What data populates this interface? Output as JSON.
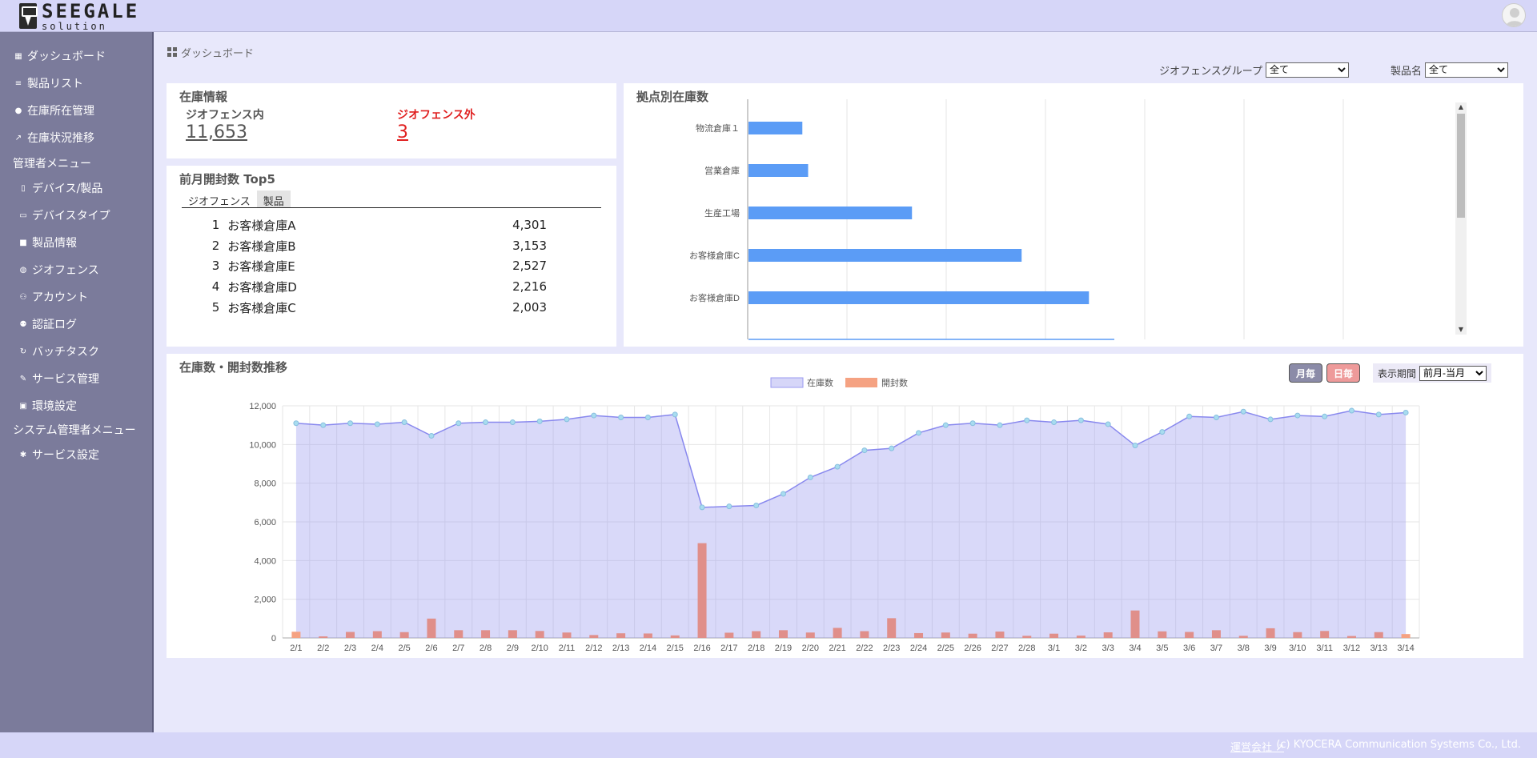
{
  "header": {
    "logo_main": "SEEGALE",
    "logo_sub": "solution"
  },
  "sidebar": {
    "items": [
      {
        "label": "ダッシュボード",
        "icon": "dashboard-icon"
      },
      {
        "label": "製品リスト",
        "icon": "list-icon"
      },
      {
        "label": "在庫所在管理",
        "icon": "map-pin-icon"
      },
      {
        "label": "在庫状況推移",
        "icon": "trend-icon"
      }
    ],
    "admin_heading": "管理者メニュー",
    "admin_items": [
      {
        "label": "デバイス/製品",
        "icon": "device-icon"
      },
      {
        "label": "デバイスタイプ",
        "icon": "device-type-icon"
      },
      {
        "label": "製品情報",
        "icon": "tag-icon"
      },
      {
        "label": "ジオフェンス",
        "icon": "globe-icon"
      },
      {
        "label": "アカウント",
        "icon": "users-icon"
      },
      {
        "label": "認証ログ",
        "icon": "user-log-icon"
      },
      {
        "label": "バッチタスク",
        "icon": "refresh-icon"
      },
      {
        "label": "サービス管理",
        "icon": "wrench-icon"
      },
      {
        "label": "環境設定",
        "icon": "settings-box-icon"
      }
    ],
    "sysadmin_heading": "システム管理者メニュー",
    "sysadmin_items": [
      {
        "label": "サービス設定",
        "icon": "gear-icon"
      }
    ]
  },
  "breadcrumb": "ダッシュボード",
  "filters": {
    "geofence_group_label": "ジオフェンスグループ",
    "geofence_group_value": "全て",
    "product_label": "製品名",
    "product_value": "全て"
  },
  "inventory": {
    "title": "在庫情報",
    "inside_label": "ジオフェンス内",
    "inside_value": "11,653",
    "outside_label": "ジオフェンス外",
    "outside_value": "3",
    "outside_color": "#e02020"
  },
  "top5": {
    "title": "前月開封数 Top5",
    "tabs": [
      "ジオフェンス",
      "製品"
    ],
    "rows": [
      {
        "rank": "1",
        "name": "お客様倉庫A",
        "value": "4,301"
      },
      {
        "rank": "2",
        "name": "お客様倉庫B",
        "value": "3,153"
      },
      {
        "rank": "3",
        "name": "お客様倉庫E",
        "value": "2,527"
      },
      {
        "rank": "4",
        "name": "お客様倉庫D",
        "value": "2,216"
      },
      {
        "rank": "5",
        "name": "お客様倉庫C",
        "value": "2,003"
      }
    ]
  },
  "base_chart_title": "拠点別在庫数",
  "trend": {
    "title": "在庫数・開封数推移",
    "monthly_label": "月毎",
    "daily_label": "日毎",
    "period_label": "表示期間",
    "period_value": "前月-当月"
  },
  "footer": {
    "company_link": "運営会社",
    "copyright": "(c) KYOCERA Communication Systems Co., Ltd."
  },
  "chart_data": [
    {
      "type": "bar",
      "orientation": "horizontal",
      "title": "拠点別在庫数",
      "categories": [
        "物流倉庫１",
        "営業倉庫",
        "生産工場",
        "お客様倉庫C",
        "お客様倉庫D"
      ],
      "values": [
        280,
        310,
        850,
        1420,
        1770
      ],
      "xlim": [
        0,
        3600
      ],
      "color": "#5b9cf6",
      "grid": true
    },
    {
      "type": "bar+line",
      "title": "在庫数・開封数推移",
      "legend": [
        "在庫数",
        "開封数"
      ],
      "legend_position": "top",
      "categories": [
        "2/1",
        "2/2",
        "2/3",
        "2/4",
        "2/5",
        "2/6",
        "2/7",
        "2/8",
        "2/9",
        "2/10",
        "2/11",
        "2/12",
        "2/13",
        "2/14",
        "2/15",
        "2/16",
        "2/17",
        "2/18",
        "2/19",
        "2/20",
        "2/21",
        "2/22",
        "2/23",
        "2/24",
        "2/25",
        "2/26",
        "2/27",
        "2/28",
        "3/1",
        "3/2",
        "3/3",
        "3/4",
        "3/5",
        "3/6",
        "3/7",
        "3/8",
        "3/9",
        "3/10",
        "3/11",
        "3/12",
        "3/13",
        "3/14"
      ],
      "series": [
        {
          "name": "在庫数",
          "type": "area",
          "color": "#9b9bf0",
          "values": [
            11100,
            11000,
            11100,
            11050,
            11150,
            10450,
            11100,
            11150,
            11150,
            11200,
            11300,
            11500,
            11400,
            11400,
            11550,
            6750,
            6800,
            6850,
            7450,
            8300,
            8850,
            9700,
            9800,
            10600,
            11000,
            11100,
            11000,
            11250,
            11150,
            11250,
            11050,
            9950,
            10650,
            11450,
            11400,
            11700,
            11300,
            11500,
            11450,
            11750,
            11550,
            11650
          ]
        },
        {
          "name": "開封数",
          "type": "bar",
          "color": "#f5a282",
          "values": [
            320,
            80,
            310,
            350,
            300,
            1000,
            400,
            400,
            400,
            360,
            280,
            150,
            240,
            230,
            130,
            4900,
            270,
            350,
            400,
            280,
            520,
            350,
            1020,
            250,
            280,
            220,
            330,
            110,
            220,
            120,
            290,
            1420,
            340,
            310,
            400,
            110,
            500,
            300,
            360,
            100,
            300,
            200
          ]
        }
      ],
      "ylim": [
        0,
        12000
      ],
      "yticks": [
        "0",
        "2,000",
        "4,000",
        "6,000",
        "8,000",
        "10,000",
        "12,000"
      ],
      "grid": true
    }
  ]
}
